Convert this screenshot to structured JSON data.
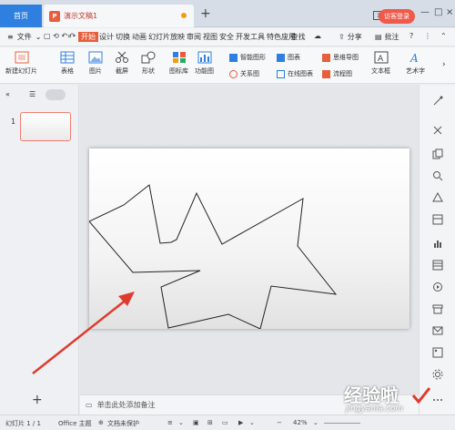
{
  "titlebar": {
    "home_tab": "首页",
    "doc_tab": "演示文稿1",
    "doc_icon_letter": "P",
    "new_tab": "+",
    "window_badge": "1",
    "login_button": "访客登录"
  },
  "menubar": {
    "file": "文件",
    "tabs": [
      "开始",
      "设计",
      "切换",
      "动画",
      "幻灯片放映",
      "审阅",
      "视图",
      "安全",
      "开发工具",
      "特色应用"
    ],
    "active_tab": "开始",
    "search": "查找",
    "share": "分享",
    "comment": "批注",
    "help": "?"
  },
  "ribbon": {
    "new_slide": "新建幻灯片",
    "table": "表格",
    "image": "图片",
    "screenshot": "截屏",
    "shape": "形状",
    "icon_lib": "图标库",
    "func_chart": "功能图",
    "smart_shape": "智能图形",
    "relation_chart": "关系图",
    "chart": "图表",
    "online_chart": "在线图表",
    "mind_map": "思维导图",
    "flow_chart": "流程图",
    "text_box": "文本框",
    "art_text": "艺术字"
  },
  "left_panel": {
    "slide_number": "1",
    "add_slide": "+"
  },
  "notes": {
    "placeholder": "单击此处添加备注"
  },
  "statusbar": {
    "slide_info": "幻灯片 1 / 1",
    "theme": "Office 主题",
    "protect": "文档未保护",
    "zoom": "42%"
  },
  "watermark": {
    "text": "经验啦",
    "url": "jingyanla.com"
  },
  "colors": {
    "accent_blue": "#2f7fe0",
    "accent_red": "#e85d3b",
    "arrow_red": "#e03a2e"
  }
}
